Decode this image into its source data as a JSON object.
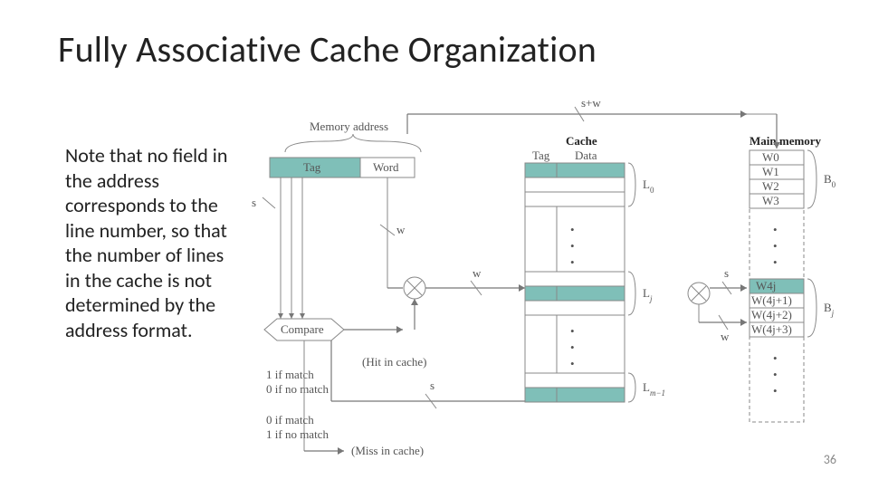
{
  "title": "Fully Associative Cache Organization",
  "body": "Note that no field in the address corresponds to the line number, so that the number of lines in the cache is not determined by the address format.",
  "page_number": "36",
  "diagram": {
    "top_bus": "s+w",
    "memory_address_label": "Memory address",
    "memory_address_fields": {
      "tag": "Tag",
      "word": "Word"
    },
    "field_widths": {
      "s": "s",
      "w": "w"
    },
    "compare_block": "Compare",
    "hit_label": "(Hit in cache)",
    "miss_label": "(Miss in cache)",
    "match_text_1": "1 if match",
    "match_text_0": "0 if no match",
    "miss_text_0": "0 if match",
    "miss_text_1": "1 if no match",
    "cache_header": "Cache",
    "cache_cols": {
      "tag": "Tag",
      "data": "Data"
    },
    "cache_lines": [
      "L0",
      "Lj",
      "Lm-1"
    ],
    "mux_out_labels": {
      "s": "s",
      "w": "w"
    },
    "main_memory_header": "Main memory",
    "memory_words_top": [
      "W0",
      "W1",
      "W2",
      "W3"
    ],
    "memory_block_top": "B0",
    "memory_words_mid": [
      "W4j",
      "W(4j+1)",
      "W(4j+2)",
      "W(4j+3)"
    ],
    "memory_block_mid": "Bj"
  }
}
